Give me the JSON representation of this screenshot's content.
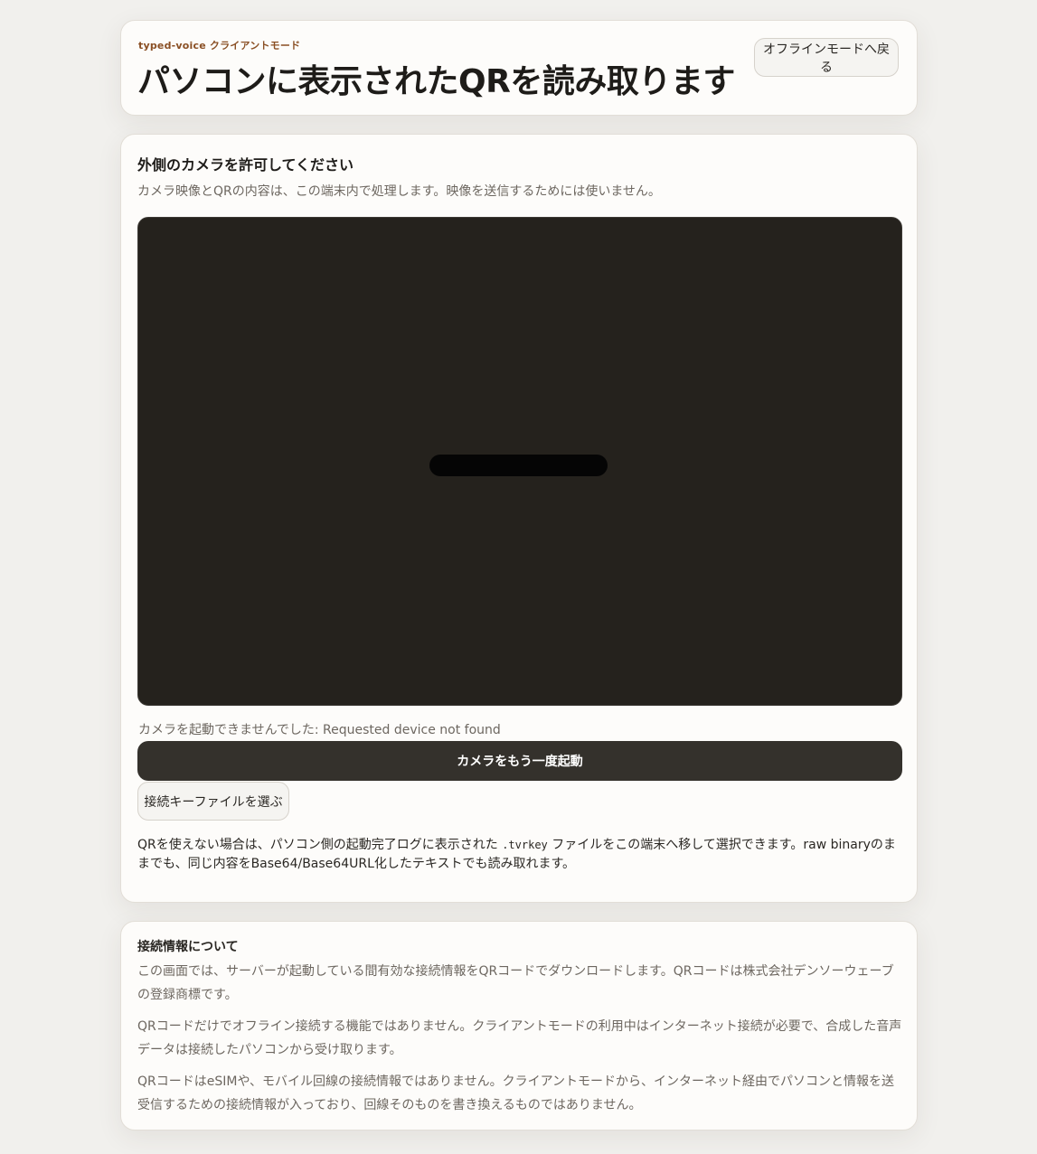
{
  "header": {
    "eyebrow": "typed-voice クライアントモード",
    "title": "パソコンに表示されたQRを読み取ります",
    "back_button_label": "オフラインモードへ戻る"
  },
  "camera": {
    "title": "外側のカメラを許可してください",
    "description": "カメラ映像とQRの内容は、この端末内で処理します。映像を送信するためには使いません。",
    "error_message": "カメラを起動できませんでした: Requested device not found",
    "retry_button_label": "カメラをもう一度起動",
    "file_button_label": "接続キーファイルを選ぶ",
    "help_before": "QRを使えない場合は、パソコン側の起動完了ログに表示された ",
    "help_code": ".tvrkey",
    "help_after": " ファイルをこの端末へ移して選択できます。raw binaryのままでも、同じ内容をBase64/Base64URL化したテキストでも読み取れます。"
  },
  "info": {
    "title": "接続情報について",
    "paragraphs": [
      "この画面では、サーバーが起動している間有効な接続情報をQRコードでダウンロードします。QRコードは株式会社デンソーウェーブの登録商標です。",
      "QRコードだけでオフライン接続する機能ではありません。クライアントモードの利用中はインターネット接続が必要で、合成した音声データは接続したパソコンから受け取ります。",
      "QRコードはeSIMや、モバイル回線の接続情報ではありません。クライアントモードから、インターネット経由でパソコンと情報を送受信するための接続情報が入っており、回線そのものを書き換えるものではありません。"
    ]
  },
  "colors": {
    "page_background": "#f1f0ed",
    "card_background": "#fdfcfa",
    "eyebrow": "#8a4f24",
    "primary_button": "#34312c",
    "camera_viewport": "#25221d"
  }
}
